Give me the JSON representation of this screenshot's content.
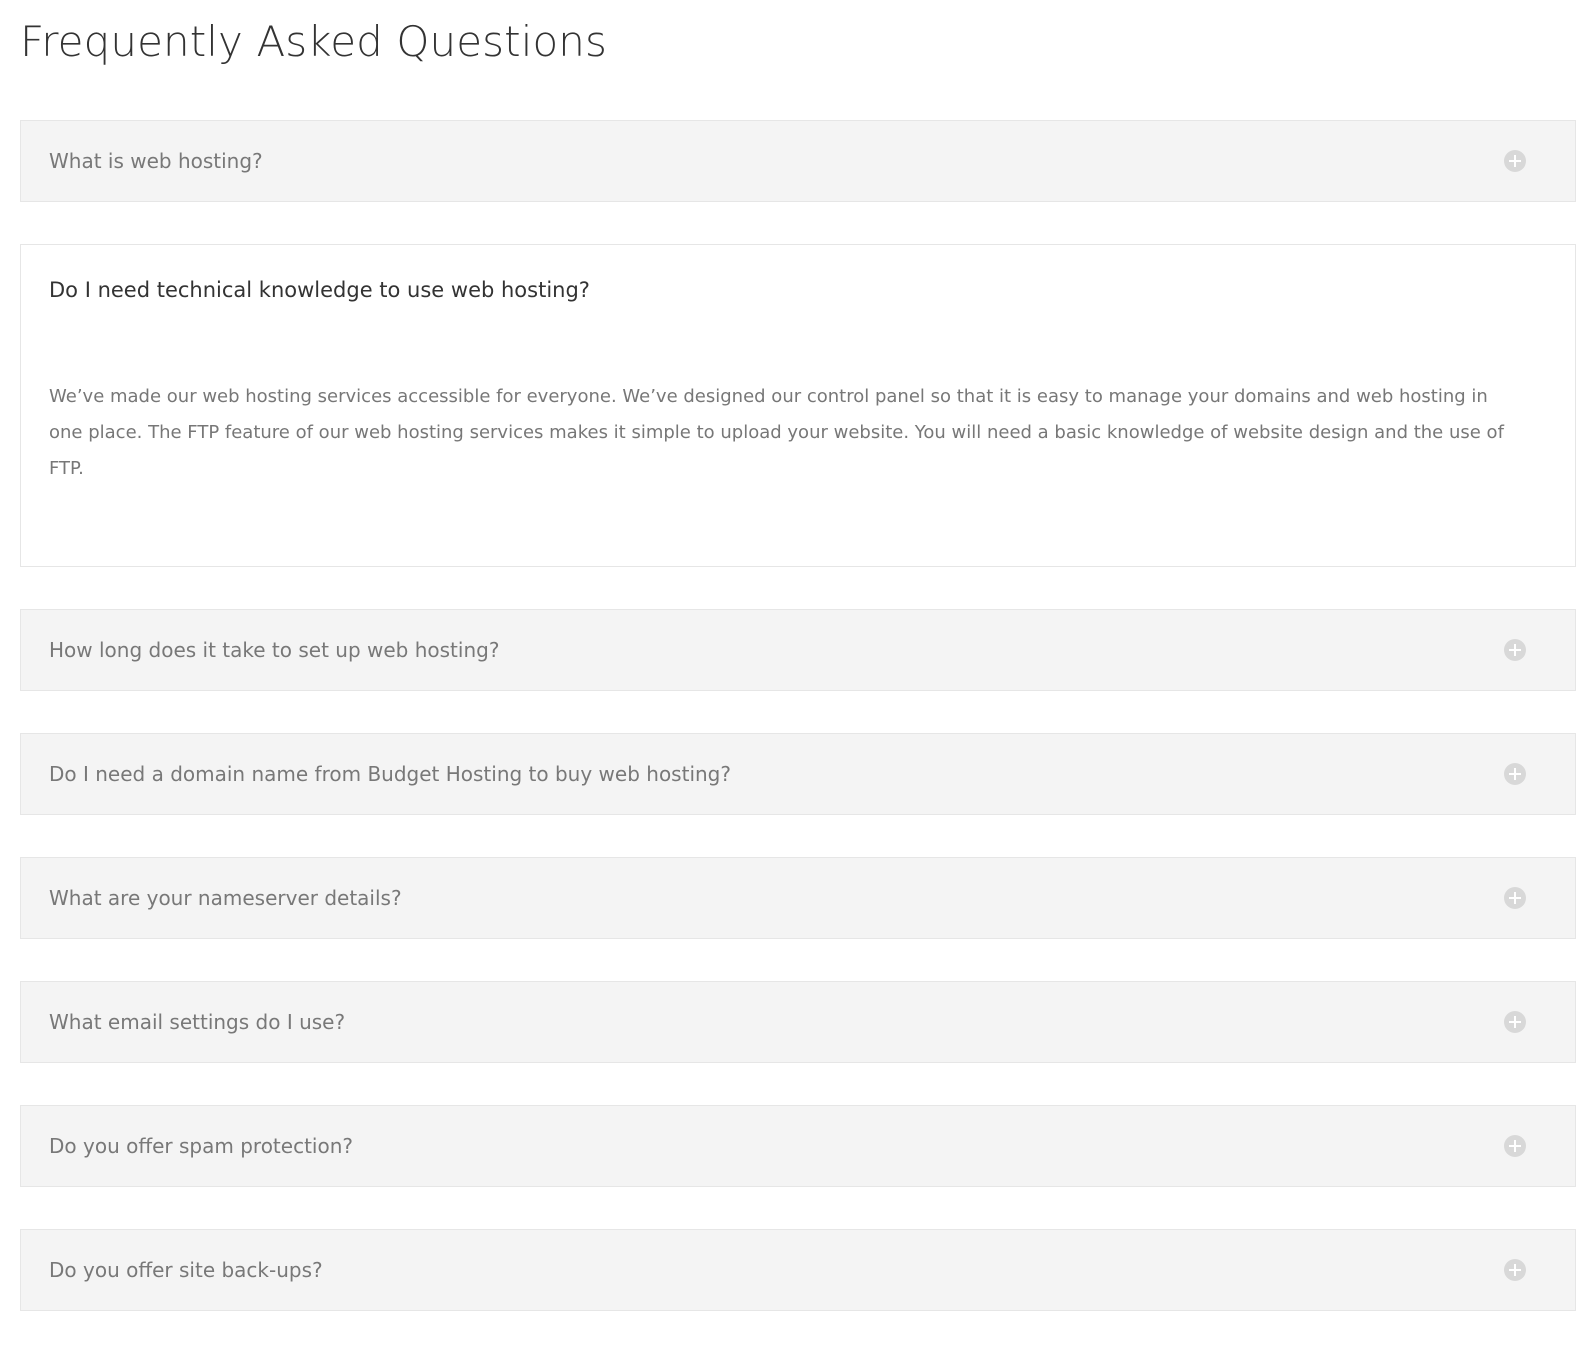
{
  "page": {
    "title": "Frequently Asked Questions"
  },
  "icons": {
    "expand": "plus-circle-icon"
  },
  "colors": {
    "page_background": "#ffffff",
    "row_background": "#f4f4f4",
    "row_border": "#e6e6e6",
    "panel_background": "#ffffff",
    "title_text": "#333333",
    "collapsed_question_text": "#787878",
    "expanded_question_text": "#333333",
    "answer_text": "#777777",
    "icon_circle": "#d8d8d8",
    "icon_glyph": "#ffffff"
  },
  "faq": {
    "items": [
      {
        "question": "What is web hosting?",
        "expanded": false,
        "answer": ""
      },
      {
        "question": "Do I need technical knowledge to use web hosting?",
        "expanded": true,
        "answer": "We’ve made our web hosting services accessible for everyone. We’ve designed our control panel so that it is easy to manage your domains and web hosting in one place. The FTP feature of our web hosting services makes it simple to upload your website. You will need a basic knowledge of website design and the use of FTP."
      },
      {
        "question": "How long does it take to set up web hosting?",
        "expanded": false,
        "answer": ""
      },
      {
        "question": "Do I need a domain name from Budget Hosting to buy web hosting?",
        "expanded": false,
        "answer": ""
      },
      {
        "question": "What are your nameserver details?",
        "expanded": false,
        "answer": ""
      },
      {
        "question": "What email settings do I use?",
        "expanded": false,
        "answer": ""
      },
      {
        "question": "Do you offer spam protection?",
        "expanded": false,
        "answer": ""
      },
      {
        "question": "Do you offer site back-ups?",
        "expanded": false,
        "answer": ""
      }
    ]
  }
}
